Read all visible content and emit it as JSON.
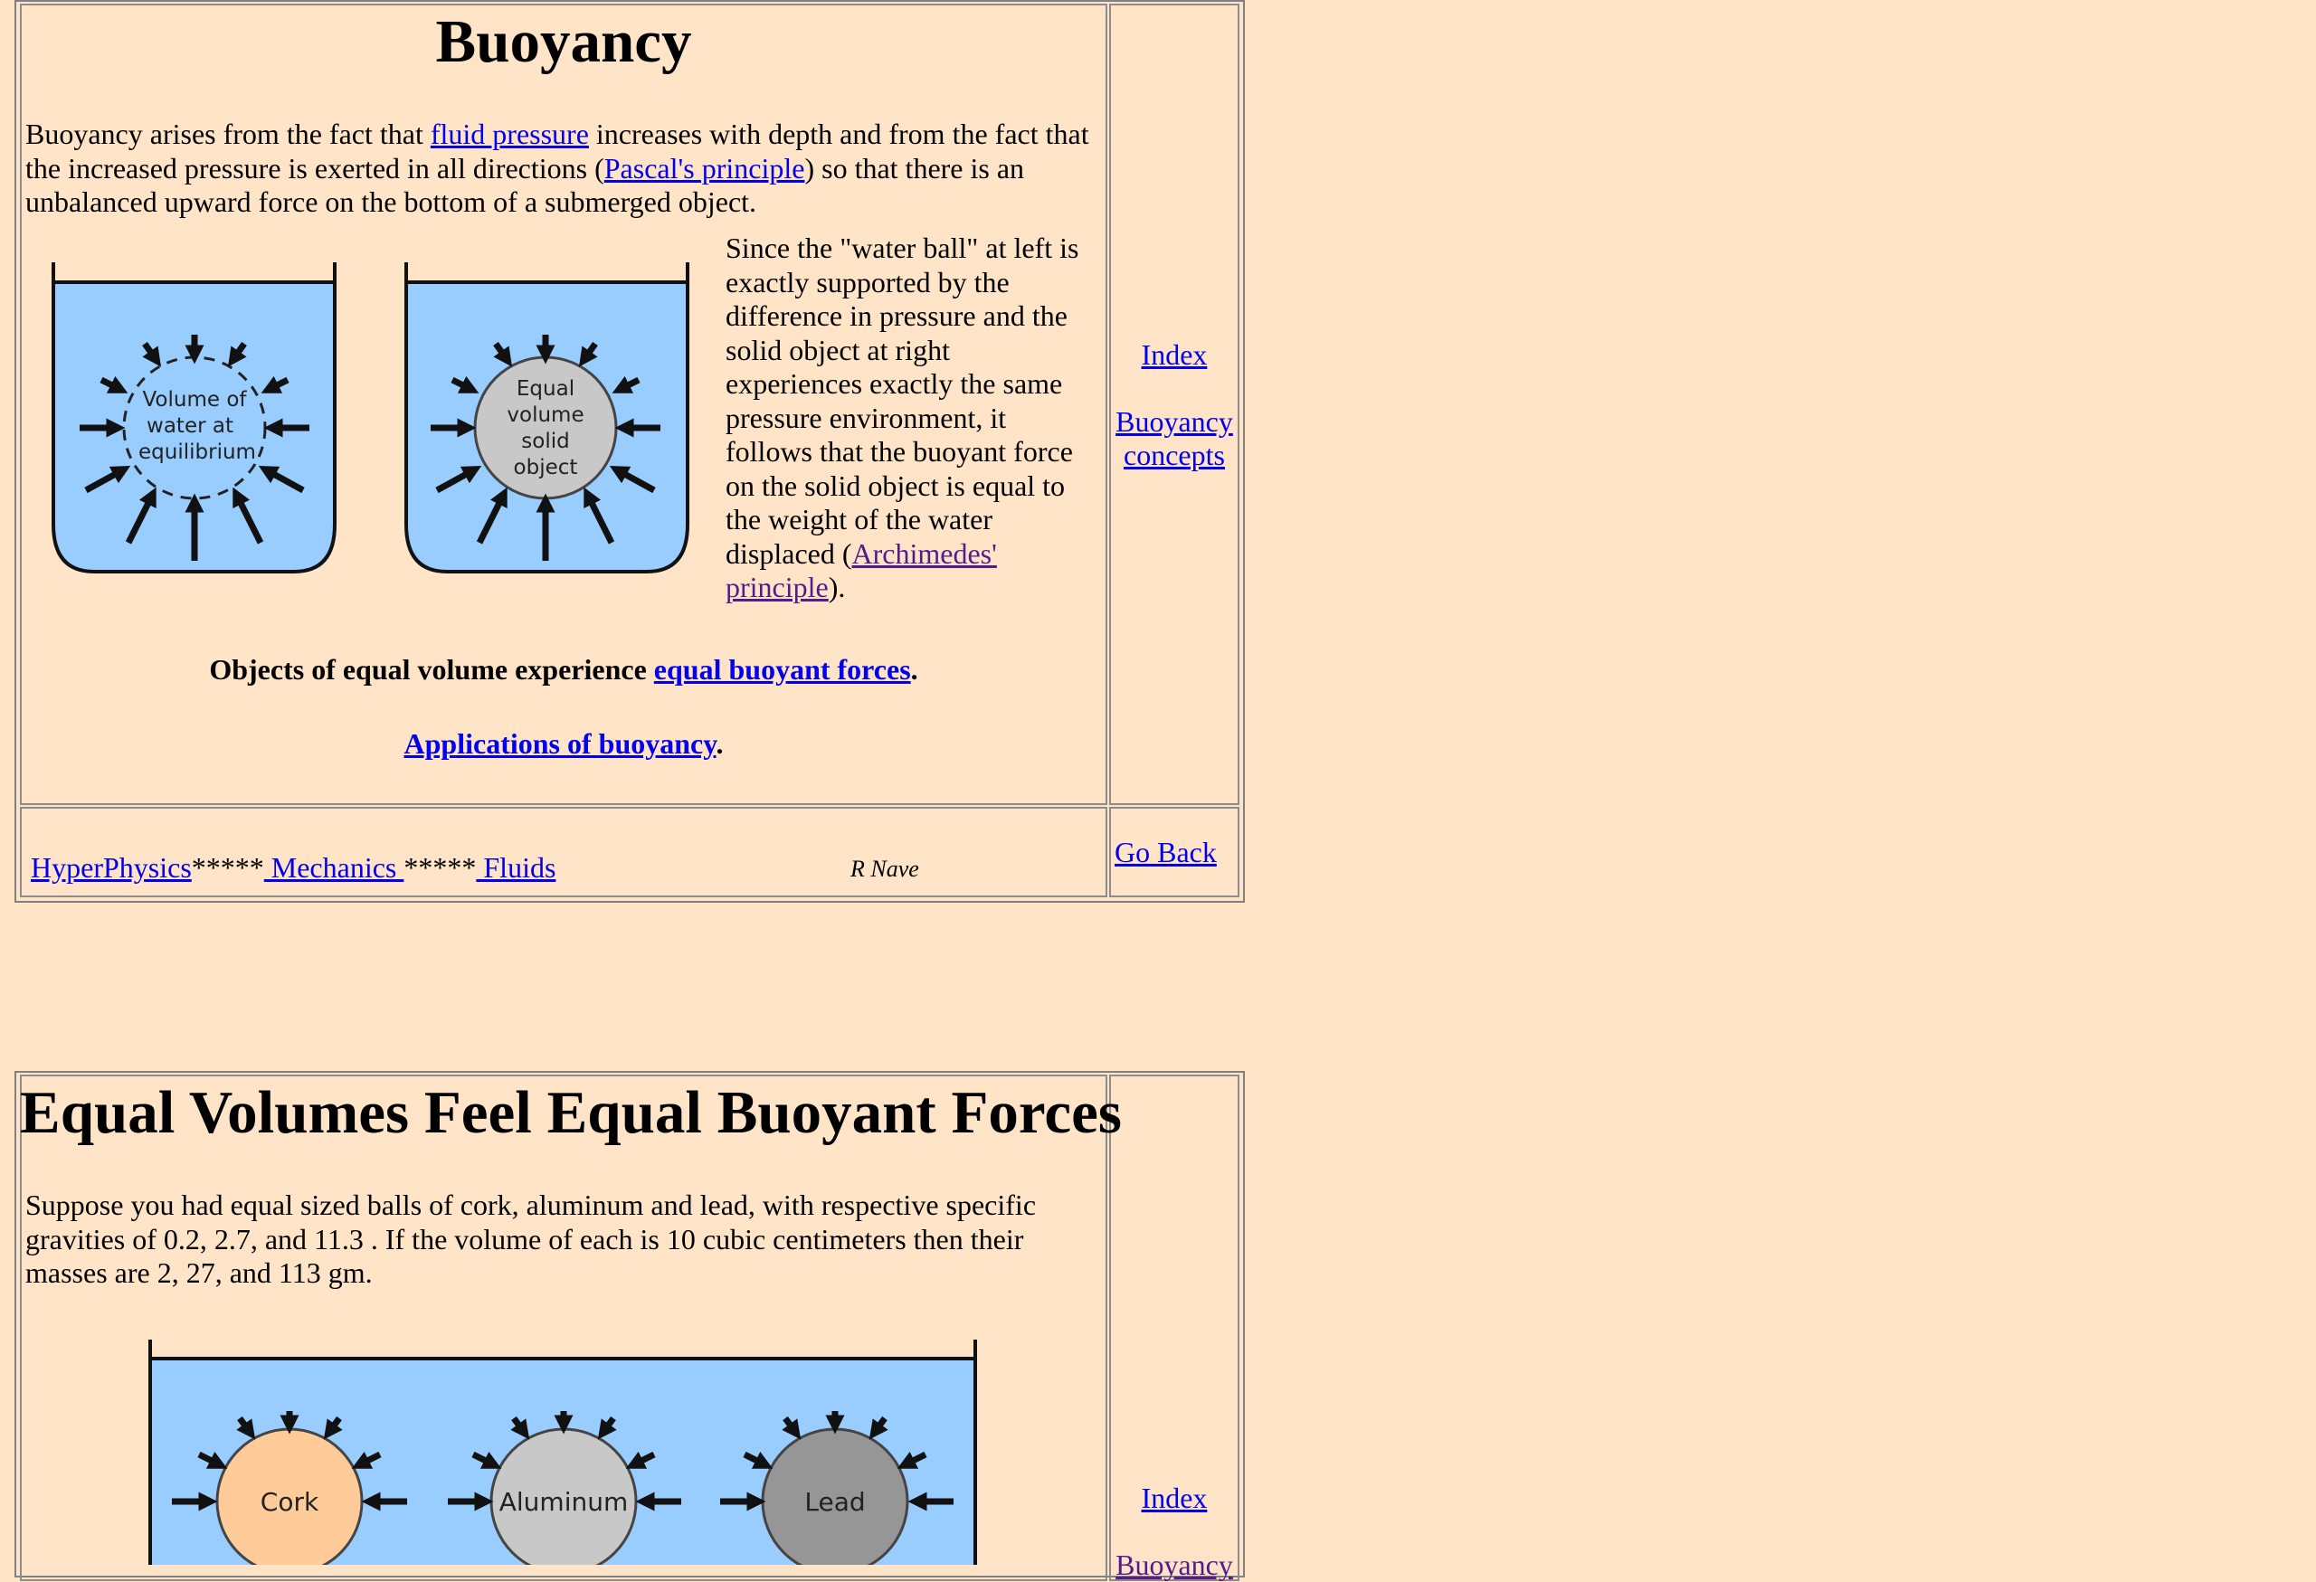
{
  "section1": {
    "title": "Buoyancy",
    "intro": {
      "t1": "Buoyancy arises from the fact that ",
      "link1": "fluid pressure",
      "t2": " increases with depth and from the fact that the increased pressure is exerted in all directions (",
      "link2": "Pascal's principle",
      "t3": ") so that there is an unbalanced upward force on the bottom of a submerged object."
    },
    "figure": {
      "left_label": [
        "Volume of",
        "water at",
        "equilibrium"
      ],
      "right_label": [
        "Equal",
        "volume",
        "solid",
        "object"
      ],
      "fill_color": "#99CCFF",
      "sphere_color": "#C8C8C8"
    },
    "side": {
      "t1": "Since the \"water ball\" at left is exactly supported by the difference in pressure and the solid object at right experiences exactly the same pressure environment, it follows that the buoyant force on the solid object is equal to the weight of the water displaced (",
      "link": "Archimedes' principle",
      "t2": ")."
    },
    "equal_line": {
      "text": "Objects of equal volume experience ",
      "link": "equal buoyant forces",
      "end": "."
    },
    "apps_line": {
      "link": "Applications of buoyancy",
      "end": "."
    },
    "nav": {
      "index": "Index",
      "concepts": "Buoyancy concepts"
    }
  },
  "footer": {
    "hyperphysics": "HyperPhysics",
    "stars1": "*****",
    "mechanics": " Mechanics ",
    "stars2": "*****",
    "fluids": " Fluids",
    "author": "R Nave",
    "go_back": "Go Back"
  },
  "section2": {
    "title": "Equal Volumes Feel Equal Buoyant Forces",
    "para": "Suppose you had equal sized balls of cork, aluminum and lead, with respective specific gravities of 0.2, 2.7, and 11.3 . If the volume of each is 10 cubic centimeters then their masses are 2, 27, and 113 gm.",
    "balls": [
      "Cork",
      "Aluminum",
      "Lead"
    ],
    "ball_colors": [
      "#FFCC99",
      "#C8C8C8",
      "#969696"
    ],
    "nav": {
      "index": "Index",
      "concepts_partial": "Buoyancy"
    }
  }
}
